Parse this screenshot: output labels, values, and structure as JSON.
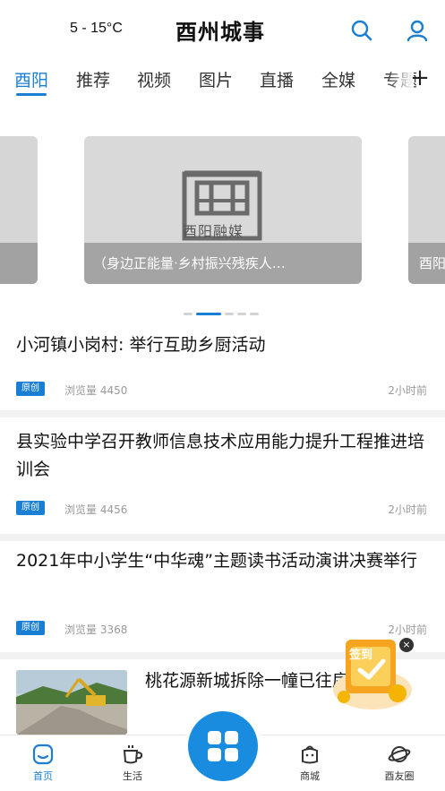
{
  "header": {
    "weather": "5 - 15°C",
    "app_title": "酉州城事",
    "icons": [
      "search-icon",
      "user-icon"
    ]
  },
  "tabs": [
    {
      "label": "酉阳",
      "active": true
    },
    {
      "label": "推荐",
      "active": false
    },
    {
      "label": "视频",
      "active": false
    },
    {
      "label": "图片",
      "active": false
    },
    {
      "label": "直播",
      "active": false
    },
    {
      "label": "全媒",
      "active": false
    },
    {
      "label": "专题",
      "active": false
    }
  ],
  "tabs_more": "+",
  "carousel": {
    "logo_text": "酉阳融媒",
    "caption": "（身边正能量·乡村振兴残疾人…",
    "side_caption": "酉阳"
  },
  "news": [
    {
      "title": "小河镇小岗村: 举行互助乡厨活动",
      "badge": "原创",
      "views": "浏览量 4450",
      "time": "2小时前"
    },
    {
      "title": "县实验中学召开教师信息技术应用能力提升工程推进培训会",
      "badge": "原创",
      "views": "浏览量 4456",
      "time": "2小时前"
    },
    {
      "title": "2021年中小学生“中华魂”主题读书活动演讲决赛举行",
      "badge": "原创",
      "views": "浏览量 3368",
      "time": "2小时前"
    },
    {
      "title": "桃花源新城拆除一幢已往房屋"
    }
  ],
  "checkin": {
    "label": "签到",
    "close": "×"
  },
  "bottom_nav": [
    {
      "label": "首页",
      "icon": "home-icon",
      "active": true
    },
    {
      "label": "生活",
      "icon": "cup-icon",
      "active": false
    },
    {
      "label": "",
      "icon": "grid-icon",
      "active": false
    },
    {
      "label": "商城",
      "icon": "bag-icon",
      "active": false
    },
    {
      "label": "酉友圈",
      "icon": "planet-icon",
      "active": false
    }
  ],
  "colors": {
    "accent": "#1a7fd4",
    "center_button": "#1a8ce0",
    "checkin": "#f5a623"
  }
}
